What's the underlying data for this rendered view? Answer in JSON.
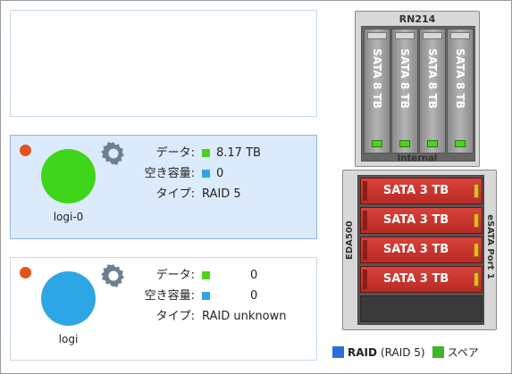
{
  "labels": {
    "data": "データ:",
    "free": "空き容量:",
    "type": "タイプ:"
  },
  "volumes": [
    {
      "name": "logi-0",
      "data": "8.17 TB",
      "free": "0",
      "type": "RAID 5",
      "circle_color": "#3fd51b",
      "selected": true
    },
    {
      "name": "logi",
      "data": "0",
      "free": "0",
      "type": "RAID unknown",
      "circle_color": "#2ea6e6",
      "selected": false
    }
  ],
  "status_color": "#e2531f",
  "chassis": {
    "title": "RN214",
    "internal_label": "Internal",
    "internal_disks": [
      "SATA 8 TB",
      "SATA 8 TB",
      "SATA 8 TB",
      "SATA 8 TB"
    ],
    "external_model": "EDA500",
    "external_port": "eSATA Port 1",
    "external_disks": [
      "SATA 3 TB",
      "SATA 3 TB",
      "SATA 3 TB",
      "SATA 3 TB"
    ]
  },
  "legend": {
    "raid_label": "RAID",
    "raid_sub": "(RAID 5)",
    "spare_label": "スペア",
    "raid_color": "#2a6fd6",
    "spare_color": "#3fb52a"
  }
}
